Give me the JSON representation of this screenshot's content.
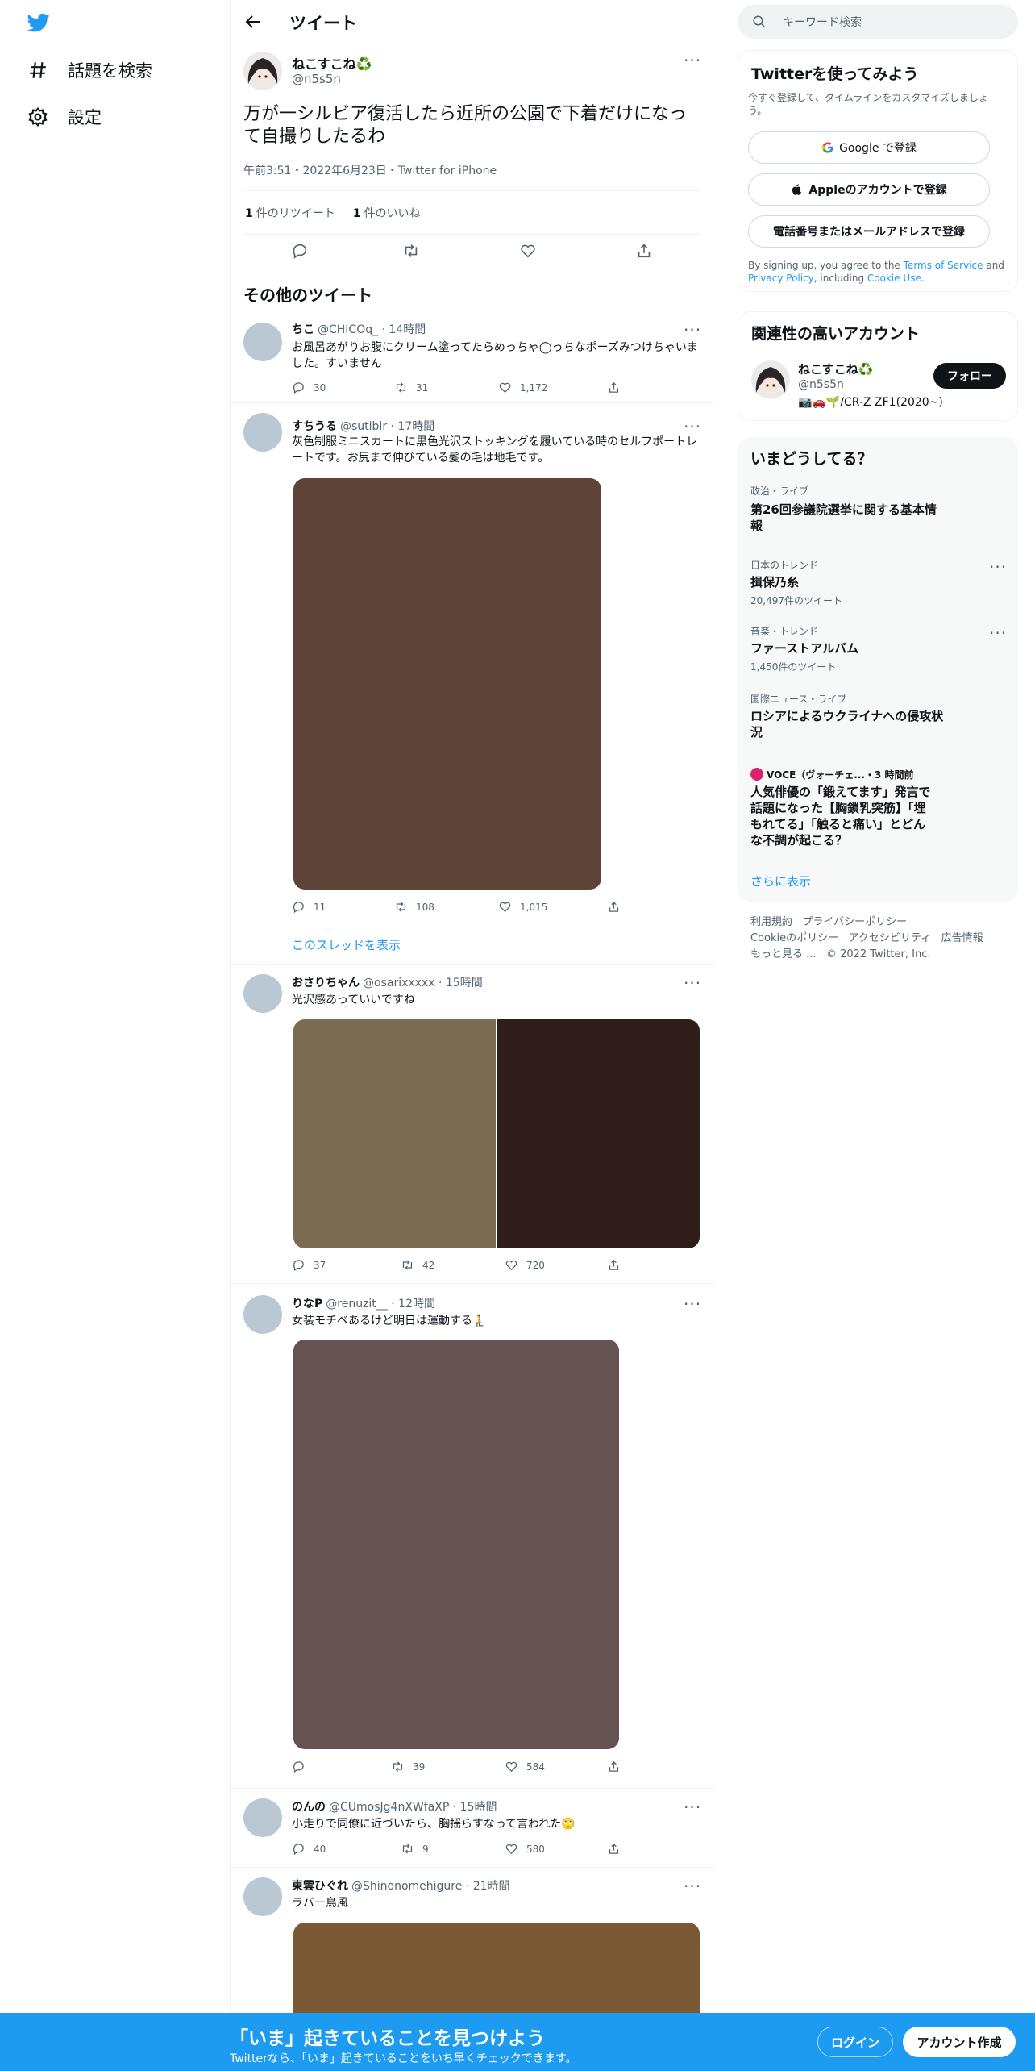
{
  "nav": {
    "items": [
      {
        "label": "話題を検索",
        "icon": "hashtag-icon"
      },
      {
        "label": "設定",
        "icon": "gear-icon"
      }
    ]
  },
  "header": {
    "title": "ツイート"
  },
  "main_tweet": {
    "name": "ねこすこね♻️",
    "handle": "@n5s5n",
    "text": "万が一シルビア復活したら近所の公園で下着だけになって自撮りしたるわ",
    "meta": "午前3:51・2022年6月23日・Twitter for iPhone",
    "retweets_count": "1",
    "retweets_label": "件のリツイート",
    "likes_count": "1",
    "likes_label": "件のいいね"
  },
  "more_tweets_title": "その他のツイート",
  "tweets": [
    {
      "name": "ちこ",
      "handle": "@CHICOq_",
      "time": "14時間",
      "text": "お風呂あがりお腹にクリーム塗ってたらめっちゃ◯っちなポーズみつけちゃいました。すいません",
      "replies": "30",
      "retweets": "31",
      "likes": "1,172"
    },
    {
      "name": "すちうる",
      "handle": "@sutiblr",
      "time": "17時間",
      "text": "灰色制服ミニスカートに黒色光沢ストッキングを履いている時のセルフポートレートです。お尻まで伸びている髪の毛は地毛です。",
      "replies": "11",
      "retweets": "108",
      "likes": "1,015",
      "thread_link": "このスレッドを表示"
    },
    {
      "name": "おさりちゃん",
      "handle": "@osarixxxxx",
      "time": "15時間",
      "text": "光沢感あっていいですね",
      "replies": "37",
      "retweets": "42",
      "likes": "720"
    },
    {
      "name": "りなP",
      "handle": "@renuzit__",
      "time": "12時間",
      "text": "女装モチベあるけど明日は運動する🧎",
      "replies": "",
      "retweets": "39",
      "likes": "584"
    },
    {
      "name": "のんの",
      "handle": "@CUmosJg4nXWfaXP",
      "time": "15時間",
      "text": "小走りで同僚に近づいたら、胸揺らすなって言われた🙄",
      "replies": "40",
      "retweets": "9",
      "likes": "580"
    },
    {
      "name": "東雲ひぐれ",
      "handle": "@Shinonomehigure",
      "time": "21時間",
      "text": "ラバー鳥風"
    }
  ],
  "search": {
    "placeholder": "キーワード検索"
  },
  "signup_card": {
    "title": "Twitterを使ってみよう",
    "subtitle": "今すぐ登録して、タイムラインをカスタマイズしましょう。",
    "google_label": "Google で登録",
    "apple_label": "Appleのアカウントで登録",
    "phone_label": "電話番号またはメールアドレスで登録",
    "terms_prefix": "By signing up, you agree to the ",
    "terms_link": "Terms of Service",
    "terms_and": " and ",
    "privacy_link": "Privacy Policy",
    "terms_including": ", including ",
    "cookie_link": "Cookie Use",
    "terms_end": "."
  },
  "relevant_card": {
    "title": "関連性の高いアカウント",
    "name": "ねこすこね♻️",
    "handle": "@n5s5n",
    "bio": "📷🚗🌱/CR-Z ZF1(2020~)",
    "follow_label": "フォロー"
  },
  "trends_card": {
    "title": "いまどうしてる？",
    "items": [
      {
        "category": "政治・ライブ",
        "title": "第26回参議院選挙に関する基本情報",
        "sub": ""
      },
      {
        "category": "日本のトレンド",
        "title": "揖保乃糸",
        "sub": "20,497件のツイート"
      },
      {
        "category": "音楽・トレンド",
        "title": "ファーストアルバム",
        "sub": "1,450件のツイート"
      },
      {
        "category": "国際ニュース・ライブ",
        "title": "ロシアによるウクライナへの侵攻状況",
        "sub": ""
      },
      {
        "category": "VOCE（ヴォーチェ...・3 時間前",
        "title": "人気俳優の「鍛えてます」発言で話題になった【胸鎖乳突筋】「埋もれてる」「触ると痛い」とどんな不調が起こる？",
        "sub": ""
      }
    ],
    "show_more": "さらに表示"
  },
  "footer": {
    "line1a": "利用規約",
    "line1b": "プライバシーポリシー",
    "line2a": "Cookieのポリシー",
    "line2b": "アクセシビリティ",
    "line2c": "広告情報",
    "line3a": "もっと見る ...",
    "line3b": "© 2022 Twitter, Inc."
  },
  "banner": {
    "title": "「いま」起きていることを見つけよう",
    "subtitle": "Twitterなら、「いま」起きていることをいち早くチェックできます。",
    "login_label": "ログイン",
    "signup_label": "アカウント作成"
  },
  "colors": {
    "brand": "#1d9bf0",
    "media1": "#5e4438",
    "media2_left": "#7b6c51",
    "media2_right": "#2e1d18",
    "media3": "#645350",
    "media4": "#7b5935"
  }
}
